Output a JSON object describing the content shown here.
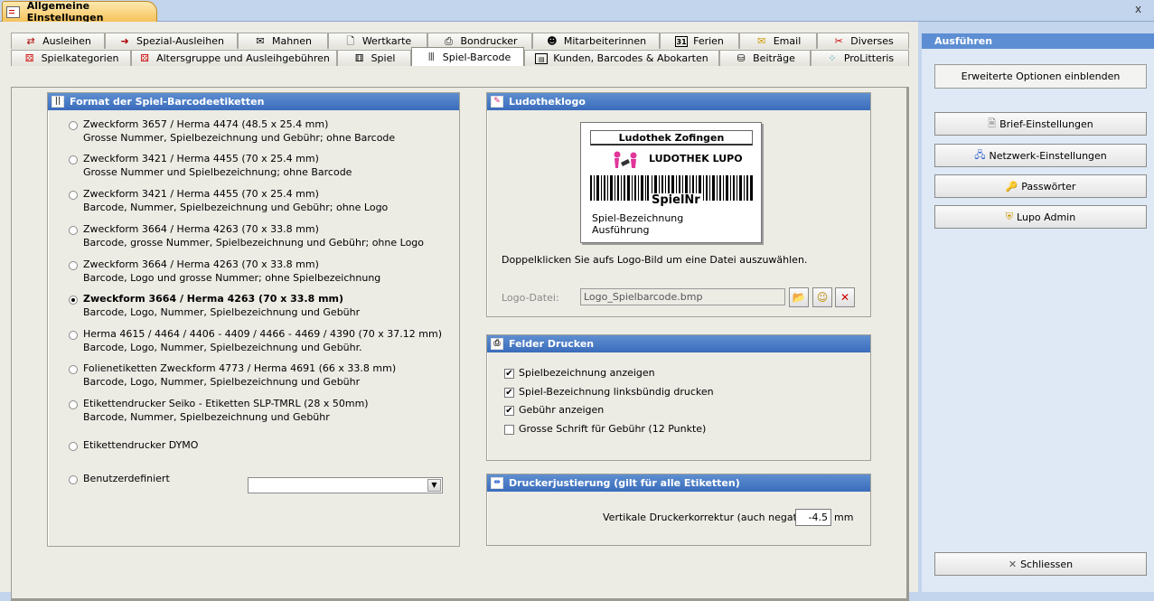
{
  "window": {
    "title": "Allgemeine Einstellungen",
    "close": "x"
  },
  "tabs_row1": [
    "Ausleihen",
    "Spezial-Ausleihen",
    "Mahnen",
    "Wertkarte",
    "Bondrucker",
    "Mitarbeiterinnen",
    "Ferien",
    "Email",
    "Diverses"
  ],
  "tabs_row2": [
    "Spielkategorien",
    "Altersgruppe und Ausleihgebühren",
    "Spiel",
    "Spiel-Barcode",
    "Kunden, Barcodes & Abokarten",
    "Beiträge",
    "ProLitteris"
  ],
  "active_tab": "Spiel-Barcode",
  "format": {
    "title": "Format der Spiel-Barcodeetiketten",
    "options": [
      {
        "l1": "Zweckform 3657 / Herma 4474 (48.5 x 25.4 mm)",
        "l2": "Grosse Nummer, Spielbezeichnung und Gebühr; ohne Barcode"
      },
      {
        "l1": "Zweckform 3421 / Herma 4455 (70 x 25.4 mm)",
        "l2": "Grosse Nummer und Spielbezeichnung; ohne Barcode"
      },
      {
        "l1": "Zweckform 3421 / Herma 4455 (70 x 25.4 mm)",
        "l2": "Barcode, Nummer, Spielbezeichnung und Gebühr; ohne Logo"
      },
      {
        "l1": "Zweckform 3664 / Herma 4263 (70 x 33.8 mm)",
        "l2": "Barcode, grosse Nummer, Spielbezeichnung und Gebühr; ohne Logo"
      },
      {
        "l1": "Zweckform 3664 / Herma 4263 (70 x 33.8 mm)",
        "l2": "Barcode, Logo und grosse Nummer; ohne Spielbezeichnung"
      },
      {
        "l1": "Zweckform 3664 / Herma 4263 (70 x 33.8 mm)",
        "l2": "Barcode, Logo, Nummer, Spielbezeichnung und Gebühr"
      },
      {
        "l1": "Herma 4615 / 4464 / 4406 - 4409 / 4466 - 4469 / 4390 (70 x 37.12 mm)",
        "l2": "Barcode, Logo, Nummer, Spielbezeichnung und Gebühr."
      },
      {
        "l1": "Folienetiketten Zweckform 4773 / Herma 4691 (66 x 33.8 mm)",
        "l2": "Barcode, Logo, Nummer, Spielbezeichnung und Gebühr"
      },
      {
        "l1": "Etikettendrucker Seiko - Etiketten SLP-TMRL (28 x 50mm)",
        "l2": "Barcode, Nummer, Spielbezeichnung und Gebühr"
      },
      {
        "l1": "Etikettendrucker DYMO",
        "l2": ""
      },
      {
        "l1": "Benutzerdefiniert",
        "l2": ""
      }
    ],
    "selected_index": 5,
    "custom_value": ""
  },
  "logo": {
    "title": "Ludotheklogo",
    "label_title": "Ludothek Zofingen",
    "brand": "LUDOTHEK LUPO",
    "barcode_text": "SpielNr",
    "desc1": "Spiel-Bezeichnung",
    "desc2": "Ausführung",
    "hint": "Doppelklicken Sie aufs Logo-Bild um eine Datei auszuwählen.",
    "file_label": "Logo-Datei:",
    "file_value": "Logo_Spielbarcode.bmp"
  },
  "print": {
    "title": "Felder Drucken",
    "items": [
      {
        "label": "Spielbezeichnung anzeigen",
        "checked": true
      },
      {
        "label": "Spiel-Bezeichnung linksbündig drucken",
        "checked": true
      },
      {
        "label": "Gebühr anzeigen",
        "checked": true
      },
      {
        "label": "Grosse Schrift für Gebühr (12 Punkte)",
        "checked": false
      }
    ]
  },
  "adjust": {
    "title": "Druckerjustierung (gilt für alle Etiketten)",
    "label": "Vertikale Druckerkorrektur (auch negative):",
    "value": "-4.5",
    "unit": "mm"
  },
  "actions": {
    "title": "Ausführen",
    "advanced": "Erweiterte Optionen einblenden",
    "letter": "Brief-Einstellungen",
    "network": "Netzwerk-Einstellungen",
    "passwords": "Passwörter",
    "admin": "Lupo Admin",
    "close": "Schliessen"
  }
}
